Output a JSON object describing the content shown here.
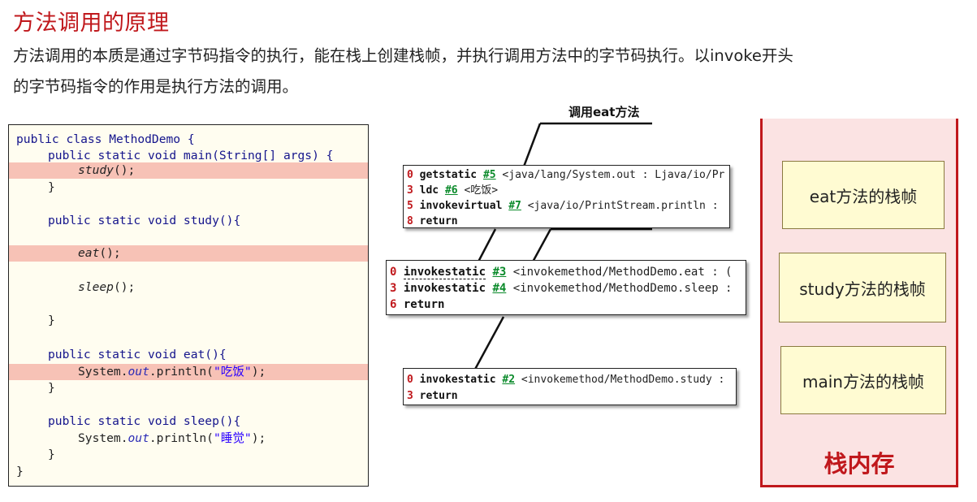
{
  "title": "方法调用的原理",
  "intro": {
    "line1": "方法调用的本质是通过字节码指令的执行，能在栈上创建栈帧，并执行调用方法中的字节码执行。以invoke开头",
    "line2": "的字节码指令的作用是执行方法的调用。"
  },
  "code": {
    "class_decl": "public class MethodDemo {",
    "main_sig": "public static void main(String[] args) {",
    "study_call": "study",
    "study_call_tail": "();",
    "close": "}",
    "study_sig": "public static void study(){",
    "eat_call": "eat",
    "eat_call_tail": "();",
    "sleep_call": "sleep",
    "sleep_call_tail": "();",
    "eat_sig": "public static void eat(){",
    "print1_prefix": "System.",
    "print1_field": "out",
    "print1_method": ".println(",
    "print1_string": "\"吃饭\"",
    "print1_end": ");",
    "sleep_sig": "public static void sleep(){",
    "print2_prefix": "System.",
    "print2_field": "out",
    "print2_method": ".println(",
    "print2_string": "\"睡觉\"",
    "print2_end": ");",
    "class_close": "}"
  },
  "callout": "调用eat方法",
  "bytecode_eat": [
    {
      "idx": "0",
      "op": "getstatic",
      "ref": "#5",
      "arg": "<java/lang/System.out : Ljava/io/Pr"
    },
    {
      "idx": "3",
      "op": "ldc",
      "ref": "#6",
      "arg": "<吃饭>"
    },
    {
      "idx": "5",
      "op": "invokevirtual",
      "ref": "#7",
      "arg": "<java/io/PrintStream.println :"
    },
    {
      "idx": "8",
      "op": "return",
      "ref": "",
      "arg": ""
    }
  ],
  "bytecode_study": [
    {
      "idx": "0",
      "op": "invokestatic",
      "ref": "#3",
      "arg": "<invokemethod/MethodDemo.eat : ("
    },
    {
      "idx": "3",
      "op": "invokestatic",
      "ref": "#4",
      "arg": "<invokemethod/MethodDemo.sleep :"
    },
    {
      "idx": "6",
      "op": "return",
      "ref": "",
      "arg": ""
    }
  ],
  "bytecode_main": [
    {
      "idx": "0",
      "op": "invokestatic",
      "ref": "#2",
      "arg": "<invokemethod/MethodDemo.study :"
    },
    {
      "idx": "3",
      "op": "return",
      "ref": "",
      "arg": ""
    }
  ],
  "stack": {
    "frames": [
      "eat方法的栈帧",
      "study方法的栈帧",
      "main方法的栈帧"
    ],
    "label": "栈内存"
  },
  "colors": {
    "accent_red": "#c0181c",
    "highlight": "#f7c2b6",
    "ref_green": "#0a8a2a",
    "stack_bg": "#fbe3e3",
    "frame_bg": "#fffbd2"
  }
}
